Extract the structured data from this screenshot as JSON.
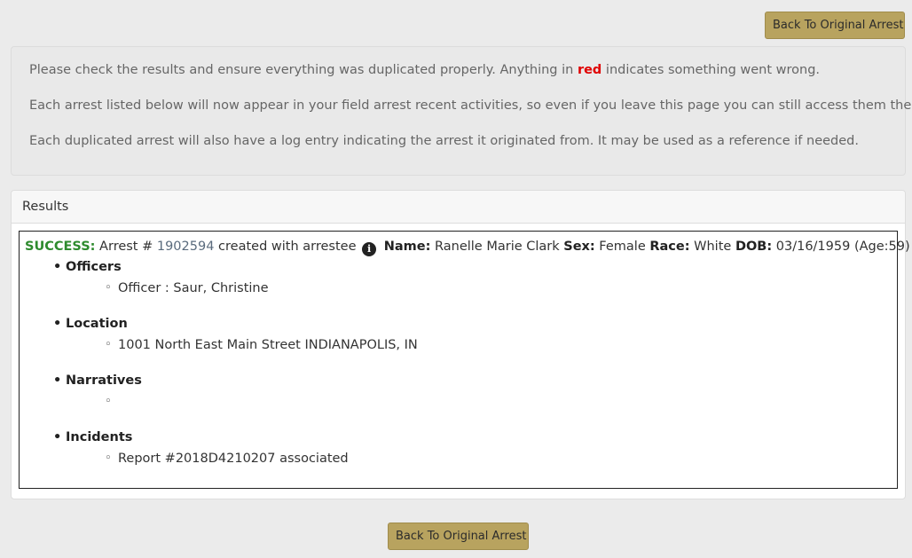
{
  "buttons": {
    "back_top": "Back To Original Arrest",
    "back_bottom": "Back To Original Arrest"
  },
  "notice": {
    "line1_before": "Please check the results and ensure everything was duplicated properly. Anything in ",
    "line1_red": "red",
    "line1_after": " indicates something went wrong.",
    "line2": "Each arrest listed below will now appear in your field arrest recent activities, so even if you leave this page you can still access them there.",
    "line3": "Each duplicated arrest will also have a log entry indicating the arrest it originated from. It may be used as a reference if needed."
  },
  "results": {
    "heading": "Results",
    "status": "SUCCESS:",
    "arrest_prefix": " Arrest # ",
    "arrest_number": "1902594",
    "arrest_suffix": " created with arrestee ",
    "info_icon_glyph": "i",
    "name_label": "Name:",
    "name_value": " Ranelle Marie Clark ",
    "sex_label": "Sex:",
    "sex_value": " Female ",
    "race_label": "Race:",
    "race_value": " White ",
    "dob_label": "DOB:",
    "dob_value": " 03/16/1959 (Age:59)",
    "sections": {
      "officers": {
        "title": "Officers",
        "item": "Officer : Saur, Christine"
      },
      "location": {
        "title": "Location",
        "item": "1001 North East Main Street INDIANAPOLIS, IN"
      },
      "narratives": {
        "title": "Narratives",
        "item": ""
      },
      "incidents": {
        "title": "Incidents",
        "item": "Report #2018D4210207 associated"
      }
    }
  },
  "colors": {
    "button_bg": "#b8a35f",
    "success": "#2e8b2e",
    "error_red": "#e00000",
    "link": "#5a6b7d"
  },
  "icons": [
    "info-icon"
  ]
}
